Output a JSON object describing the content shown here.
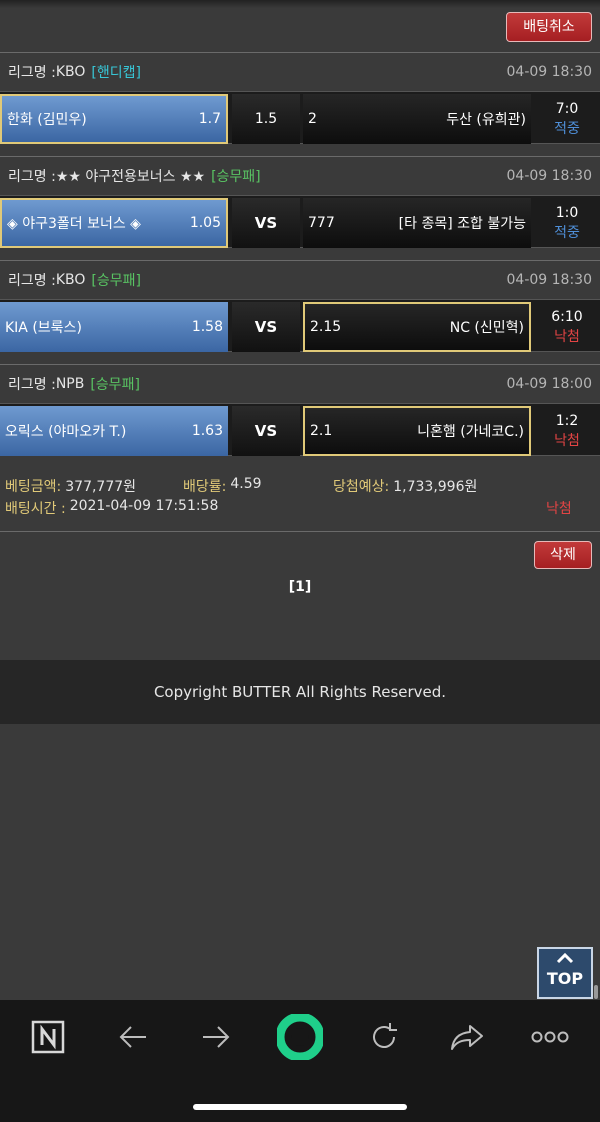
{
  "actions": {
    "cancel_label": "배팅취소",
    "delete_label": "삭제"
  },
  "bets": [
    {
      "league_prefix": "리그명 : ",
      "league": "KBO",
      "type": "[핸디캡]",
      "type_color": "cyan",
      "time": "04-09 18:30",
      "home": {
        "name": "한화 (김민우)",
        "odds": "1.7",
        "selected": true
      },
      "mid": "1.5",
      "away": {
        "odds": "2",
        "name": "두산 (유희관)",
        "selected": false
      },
      "score": "7:0",
      "status": "적중",
      "status_type": "hit"
    },
    {
      "league_prefix": "리그명 : ",
      "league": "★★ 야구전용보너스 ★★",
      "type": "[승무패]",
      "type_color": "green",
      "time": "04-09 18:30",
      "home": {
        "name": "◈ 야구3폴더 보너스 ◈",
        "odds": "1.05",
        "selected": true
      },
      "mid": "VS",
      "away": {
        "odds": "777",
        "name": "[타 종목] 조합 불가능",
        "selected": false
      },
      "score": "1:0",
      "status": "적중",
      "status_type": "hit"
    },
    {
      "league_prefix": "리그명 : ",
      "league": "KBO",
      "type": "[승무패]",
      "type_color": "green",
      "time": "04-09 18:30",
      "home": {
        "name": "KIA (브룩스)",
        "odds": "1.58",
        "selected": false
      },
      "mid": "VS",
      "away": {
        "odds": "2.15",
        "name": "NC (신민혁)",
        "selected": true
      },
      "score": "6:10",
      "status": "낙첨",
      "status_type": "miss"
    },
    {
      "league_prefix": "리그명 : ",
      "league": "NPB",
      "type": "[승무패]",
      "type_color": "green",
      "time": "04-09 18:00",
      "home": {
        "name": "오릭스 (야마오카 T.)",
        "odds": "1.63",
        "selected": false
      },
      "mid": "VS",
      "away": {
        "odds": "2.1",
        "name": "니혼햄 (가네코C.)",
        "selected": true
      },
      "score": "1:2",
      "status": "낙첨",
      "status_type": "miss"
    }
  ],
  "summary": {
    "amount_label": "베팅금액:",
    "amount": "377,777원",
    "rate_label": "배당률:",
    "rate": "4.59",
    "expected_label": "당첨예상:",
    "expected": "1,733,996원",
    "time_label": "배팅시간 :",
    "time": "2021-04-09 17:51:58",
    "result": "낙첨"
  },
  "pager": "[1]",
  "footer": "Copyright BUTTER All Rights Reserved.",
  "top_button": "TOP",
  "browser_bar": {
    "icons": [
      "naver-n-icon",
      "back-arrow-icon",
      "forward-arrow-icon",
      "home-circle-icon",
      "refresh-icon",
      "share-icon",
      "more-icon"
    ],
    "accent": "#1fcf8a"
  }
}
